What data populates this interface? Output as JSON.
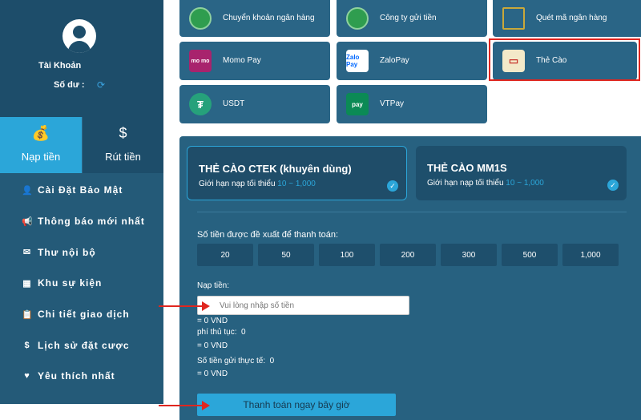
{
  "sidebar": {
    "account_label": "Tài Khoản",
    "balance_label": "Số dư :",
    "tabs": [
      {
        "label": "Nạp tiền"
      },
      {
        "label": "Rút tiền"
      }
    ],
    "menu": [
      {
        "label": "Cài Đặt Bảo Mật",
        "icon": "user-icon"
      },
      {
        "label": "Thông báo mới nhất",
        "icon": "megaphone-icon"
      },
      {
        "label": "Thư nội bộ",
        "icon": "mail-icon"
      },
      {
        "label": "Khu sự kiện",
        "icon": "calendar-icon"
      },
      {
        "label": "Chi tiết giao dịch",
        "icon": "clipboard-icon"
      },
      {
        "label": "Lịch sử đặt cược",
        "icon": "dollar-icon"
      },
      {
        "label": "Yêu thích nhất",
        "icon": "heart-icon"
      }
    ]
  },
  "methods": [
    {
      "label": "Chuyển khoản ngân hàng",
      "icon": "globe-icon"
    },
    {
      "label": "Công ty gửi tiền",
      "icon": "globe-icon"
    },
    {
      "label": "Quét mã ngân hàng",
      "icon": "qr-code-icon"
    },
    {
      "label": "Momo Pay",
      "icon": "momo-icon",
      "icon_text": "mo mo"
    },
    {
      "label": "ZaloPay",
      "icon": "zalopay-icon",
      "icon_text": "Zalo Pay"
    },
    {
      "label": "Thẻ Cào",
      "icon": "card-icon"
    },
    {
      "label": "USDT",
      "icon": "tether-icon",
      "icon_text": "₮"
    },
    {
      "label": "VTPay",
      "icon": "vtpay-icon",
      "icon_text": "pay"
    }
  ],
  "cards": [
    {
      "title": "THẺ CÀO CTEK (khuyên dùng)",
      "limit_label": "Giới hạn nạp tối thiểu",
      "range": "10 ~ 1,000",
      "selected": true
    },
    {
      "title": "THẺ CÀO MM1S",
      "limit_label": "Giới hạn nạp tối thiểu",
      "range": "10 ~ 1,000",
      "selected": true
    }
  ],
  "amount_section": {
    "label": "Số tiền được đề xuất để thanh toán:",
    "options": [
      "20",
      "50",
      "100",
      "200",
      "300",
      "500",
      "1,000"
    ]
  },
  "deposit": {
    "label": "Nạp tiền:",
    "placeholder": "Vui lòng nhập số tiền",
    "converted": "= 0 VND",
    "fee_label": "phí thủ tục:",
    "fee_value": "0",
    "fee_converted": "= 0 VND",
    "actual_label": "Số tiền gửi thực tế:",
    "actual_value": "0",
    "actual_converted": "= 0 VND"
  },
  "pay_button": "Thanh toán ngay bây giờ",
  "colors": {
    "sidebar": "#245a78",
    "panel": "#276180",
    "accent": "#2ba6d9",
    "highlight": "#e0261f"
  }
}
